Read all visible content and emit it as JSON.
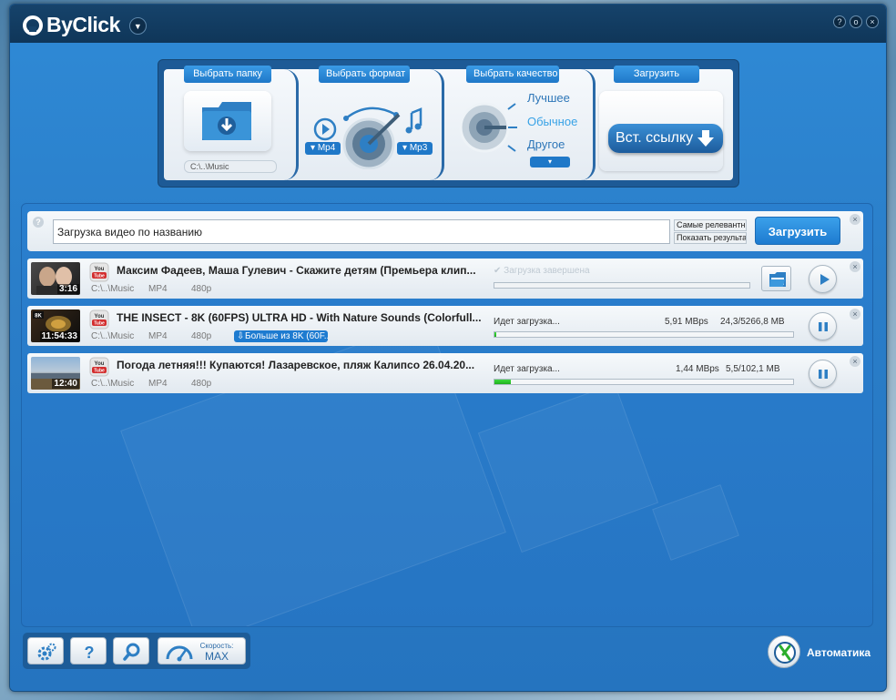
{
  "app": {
    "title": "ByClick",
    "window_buttons": [
      "?",
      "o",
      "×"
    ]
  },
  "top_panel": {
    "folder_tab": "Выбрать папку",
    "folder_path": "C:\\..\\Music",
    "format_tab": "Выбрать формат",
    "format_video": "Mp4",
    "format_audio": "Mp3",
    "quality_tab": "Выбрать качество",
    "quality_options": [
      "Лучшее",
      "Обычное",
      "Другое"
    ],
    "quality_active": "Обычное",
    "download_tab": "Загрузить",
    "paste_button": "Вст. ссылку"
  },
  "search": {
    "value": "Загрузка видео по названию",
    "sort_options": [
      "Самые релевантные",
      "Показать результаты"
    ],
    "button": "Загрузить",
    "help": "?"
  },
  "downloads": [
    {
      "duration": "3:16",
      "title": "Максим Фадеев, Маша Гулевич - Скажите детям (Премьера клип...",
      "path": "C:\\..\\Music",
      "format": "MP4",
      "quality": "480p",
      "status": "Загрузка завершена",
      "speed": "",
      "size": "",
      "progress": 0,
      "state": "completed"
    },
    {
      "duration": "11:54:33",
      "title": "THE INSECT - 8K (60FPS) ULTRA HD - With Nature Sounds (Colorfull...",
      "path": "C:\\..\\Music",
      "format": "MP4",
      "quality": "480p",
      "more": "Больше из 8K (60F...",
      "status": "Идет загрузка...",
      "speed": "5,91 MBps",
      "size": "24,3/5266,8 MB",
      "progress": 0.5,
      "state": "downloading"
    },
    {
      "duration": "12:40",
      "title": "Погода летняя!!!  Купаются! Лазаревское, пляж Калипсо 26.04.20...",
      "path": "C:\\..\\Music",
      "format": "MP4",
      "quality": "480p",
      "status": "Идет загрузка...",
      "speed": "1,44 MBps",
      "size": "5,5/102,1 MB",
      "progress": 5.4,
      "state": "downloading"
    }
  ],
  "bottom": {
    "speed_label": "Скорость:",
    "speed_value": "MAX",
    "auto_label": "Автоматика"
  },
  "colors": {
    "accent": "#1f78c8",
    "titlebar": "#0f3659",
    "progress": "#2bc42b"
  },
  "icons": [
    "settings-icon",
    "help-icon",
    "search-icon",
    "speedometer-icon",
    "folder-download-icon",
    "play-icon",
    "pause-icon",
    "youtube-icon",
    "auto-icon"
  ]
}
